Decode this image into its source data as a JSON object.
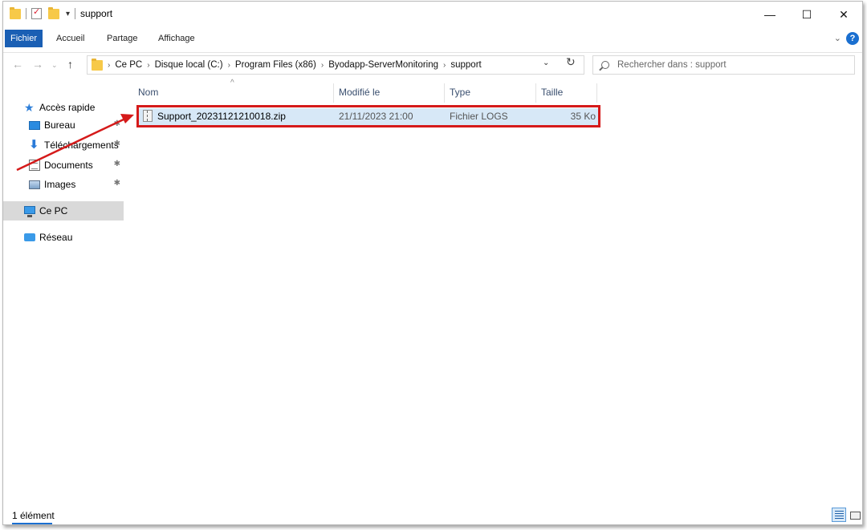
{
  "window": {
    "title": "support",
    "controls": {
      "minimize": "—",
      "maximize": "☐",
      "close": "✕"
    }
  },
  "ribbon": {
    "tabs": [
      "Fichier",
      "Accueil",
      "Partage",
      "Affichage"
    ],
    "help": "?"
  },
  "address": {
    "crumbs": [
      "Ce PC",
      "Disque local (C:)",
      "Program Files (x86)",
      "Byodapp-ServerMonitoring",
      "support"
    ],
    "separator": "›"
  },
  "search": {
    "placeholder": "Rechercher dans : support"
  },
  "navpane": {
    "items": [
      {
        "label": "Accès rapide",
        "icon": "star-icon",
        "pinned": false
      },
      {
        "label": "Bureau",
        "icon": "desktop-icon",
        "pinned": true
      },
      {
        "label": "Téléchargements",
        "icon": "download-icon",
        "pinned": true
      },
      {
        "label": "Documents",
        "icon": "documents-icon",
        "pinned": true
      },
      {
        "label": "Images",
        "icon": "pictures-icon",
        "pinned": true
      },
      {
        "label": "Ce PC",
        "icon": "computer-icon",
        "pinned": false,
        "selected": true
      },
      {
        "label": "Réseau",
        "icon": "network-icon",
        "pinned": false
      }
    ]
  },
  "filelist": {
    "columns": [
      "Nom",
      "Modifié le",
      "Type",
      "Taille"
    ],
    "rows": [
      {
        "name": "Support_20231121210018.zip",
        "modified": "21/11/2023 21:00",
        "type": "Fichier LOGS",
        "size": "35 Ko",
        "icon": "zip-file-icon",
        "selected": true
      }
    ]
  },
  "status": {
    "text": "1 élément"
  },
  "colors": {
    "accent": "#1a5fb4",
    "selection": "#d7e8f7",
    "annotation": "#d51a1a"
  }
}
